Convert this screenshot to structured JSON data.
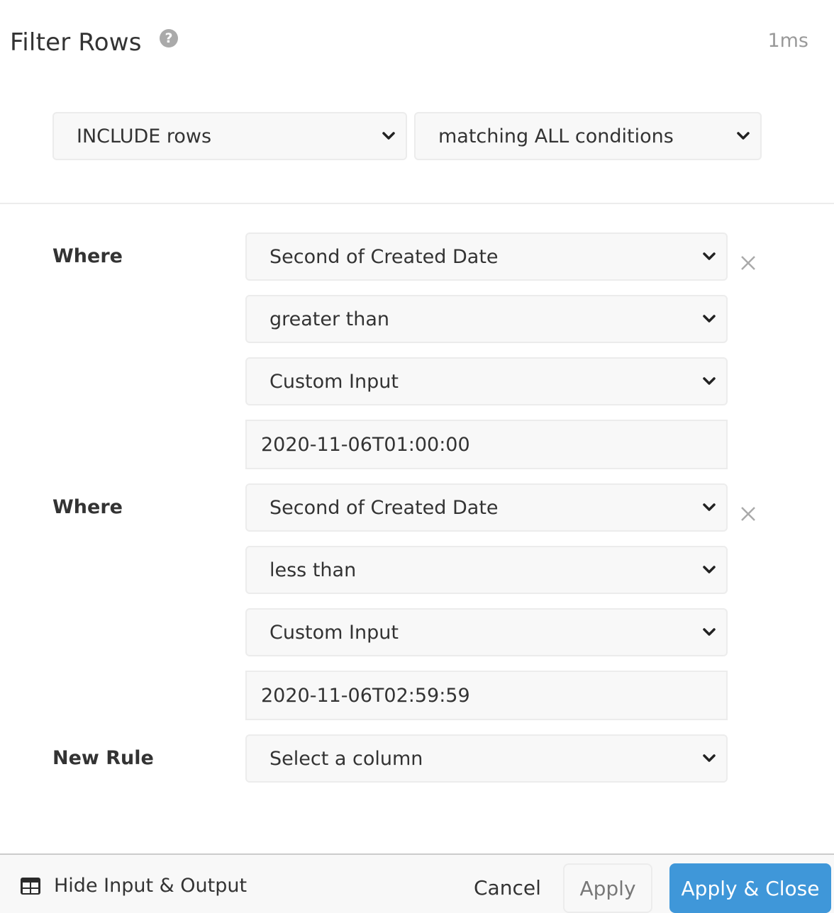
{
  "header": {
    "title": "Filter Rows",
    "help_icon": "question-circle-icon",
    "timing": "1ms"
  },
  "mode": {
    "include_select": "INCLUDE rows",
    "match_select": "matching ALL conditions"
  },
  "rules": [
    {
      "label": "Where",
      "column": "Second of Created Date",
      "operator": "greater than",
      "value_type": "Custom Input",
      "value": "2020-11-06T01:00:00"
    },
    {
      "label": "Where",
      "column": "Second of Created Date",
      "operator": "less than",
      "value_type": "Custom Input",
      "value": "2020-11-06T02:59:59"
    }
  ],
  "new_rule": {
    "label": "New Rule",
    "placeholder": "Select a column"
  },
  "footer": {
    "toggle_io": "Hide Input & Output",
    "toggle_icon": "table-icon",
    "cancel": "Cancel",
    "apply": "Apply",
    "apply_close": "Apply & Close"
  },
  "colors": {
    "primary": "#3f97d9",
    "muted_text": "#999999",
    "field_bg": "#f8f8f8",
    "border": "#ececec"
  }
}
